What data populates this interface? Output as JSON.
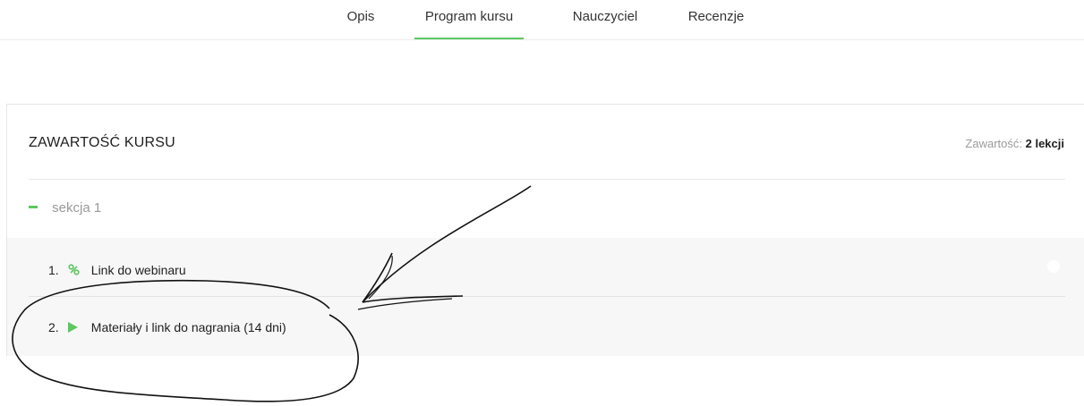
{
  "tabs": [
    {
      "label": "Opis",
      "active": false
    },
    {
      "label": "Program kursu",
      "active": true
    },
    {
      "label": "Nauczyciel",
      "active": false
    },
    {
      "label": "Recenzje",
      "active": false
    }
  ],
  "course": {
    "title": "ZAWARTOŚĆ KURSU",
    "count_label": "Zawartość:",
    "count_value": "2 lekcji",
    "section": {
      "label": "sekcja 1",
      "expanded": true,
      "lessons": [
        {
          "number": "1.",
          "icon": "link-icon",
          "title": "Link do webinaru"
        },
        {
          "number": "2.",
          "icon": "play-icon",
          "title": "Materiały i link do nagrania (14 dni)"
        }
      ]
    }
  },
  "colors": {
    "accent": "#5cc860",
    "muted_text": "#9a9a9a",
    "lessons_bg": "#f7f7f7"
  }
}
